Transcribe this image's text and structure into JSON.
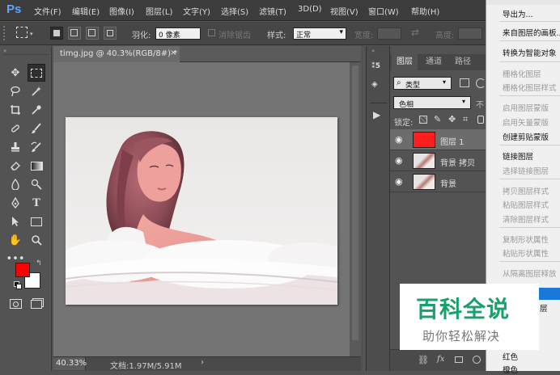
{
  "app": {
    "logo": "Ps"
  },
  "menubar": {
    "items": [
      "文件(F)",
      "编辑(E)",
      "图像(I)",
      "图层(L)",
      "文字(Y)",
      "选择(S)",
      "滤镜(T)",
      "3D(D)",
      "视图(V)",
      "窗口(W)",
      "帮助(H)"
    ]
  },
  "options": {
    "feather_label": "羽化:",
    "feather_value": "0 像素",
    "antialias_label": "消除锯齿",
    "style_label": "样式:",
    "style_value": "正常",
    "width_label": "宽度:",
    "height_label": "高度:"
  },
  "document": {
    "tab_title": "timg.jpg @ 40.3%(RGB/8#) *",
    "zoom": "40.33%",
    "doc_info": "文档:1.97M/5.91M"
  },
  "layers_panel": {
    "tabs": [
      "图层",
      "通道",
      "路径"
    ],
    "filter_label": "类型",
    "blend_mode": "色相",
    "opacity_label": "不",
    "lock_label": "锁定:",
    "layers": [
      {
        "name": "图层 1",
        "type": "fill",
        "color": "#ff1e1e"
      },
      {
        "name": "背景 拷贝",
        "type": "photo"
      },
      {
        "name": "背景",
        "type": "photo"
      }
    ]
  },
  "colors": {
    "foreground": "#ff0000",
    "background": "#ffffff",
    "selection": "#1a78d8"
  },
  "context_menu": {
    "items": [
      {
        "label": "导出为...",
        "enabled": true
      },
      {
        "label": "来自图层的画板...",
        "enabled": true
      },
      {
        "label": "转换为智能对象",
        "enabled": true
      },
      {
        "label": "栅格化图层",
        "enabled": false
      },
      {
        "label": "栅格化图层样式",
        "enabled": false
      },
      {
        "label": "启用图层蒙版",
        "enabled": false
      },
      {
        "label": "启用矢量蒙版",
        "enabled": false
      },
      {
        "label": "创建剪贴蒙版",
        "enabled": true
      },
      {
        "label": "链接图层",
        "enabled": true
      },
      {
        "label": "选择链接图层",
        "enabled": false
      },
      {
        "label": "拷贝图层样式",
        "enabled": false
      },
      {
        "label": "粘贴图层样式",
        "enabled": false
      },
      {
        "label": "清除图层样式",
        "enabled": false
      },
      {
        "label": "复制形状属性",
        "enabled": false
      },
      {
        "label": "粘贴形状属性",
        "enabled": false
      },
      {
        "label": "从隔离图层释放",
        "enabled": false
      },
      {
        "label": "层",
        "enabled": true
      },
      {
        "label": "红色",
        "enabled": true
      },
      {
        "label": "橙色",
        "enabled": true
      }
    ]
  },
  "watermark": {
    "title": "百科全说",
    "subtitle": "助你轻松解决"
  }
}
